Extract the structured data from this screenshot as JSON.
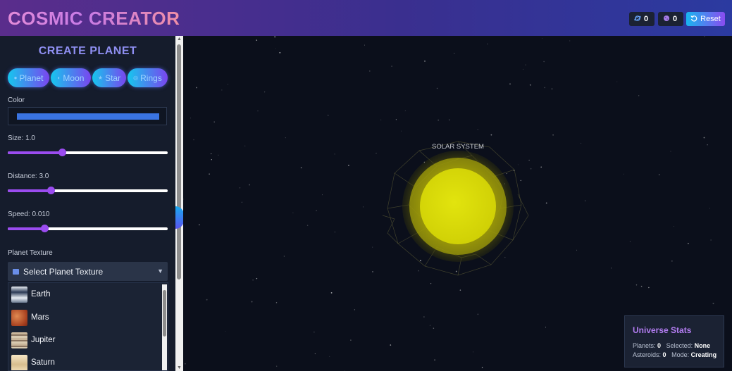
{
  "header": {
    "title": "COSMIC CREATOR",
    "counters": [
      {
        "icon": "planet-icon",
        "value": "0"
      },
      {
        "icon": "asteroid-icon",
        "value": "0"
      }
    ],
    "reset_label": "Reset"
  },
  "sidebar": {
    "title": "CREATE PLANET",
    "types": [
      {
        "label": "Planet",
        "icon": "circle-icon"
      },
      {
        "label": "Moon",
        "icon": "moon-icon"
      },
      {
        "label": "Star",
        "icon": "star-icon"
      },
      {
        "label": "Rings",
        "icon": "ring-icon"
      }
    ],
    "color_label": "Color",
    "color_value": "#3a74e2",
    "size": {
      "label": "Size: 1.0",
      "value": 1.0,
      "fraction": 0.34
    },
    "distance": {
      "label": "Distance: 3.0",
      "value": 3.0,
      "fraction": 0.27
    },
    "speed": {
      "label": "Speed: 0.010",
      "value": 0.01,
      "fraction": 0.23
    },
    "texture_label": "Planet Texture",
    "texture_select": "Select Planet Texture",
    "textures": [
      {
        "name": "Earth",
        "colors": [
          "#cfd8e6",
          "#2b3a55"
        ]
      },
      {
        "name": "Mars",
        "colors": [
          "#d0703e",
          "#8a2f1c"
        ]
      },
      {
        "name": "Jupiter",
        "colors": [
          "#c8b497",
          "#7a6550"
        ]
      },
      {
        "name": "Saturn",
        "colors": [
          "#f1ddb6",
          "#c9ad82"
        ]
      }
    ]
  },
  "scene": {
    "label": "SOLAR SYSTEM",
    "sun_color": "#d8dc0a"
  },
  "stats": {
    "title": "Universe Stats",
    "planets_label": "Planets:",
    "planets_value": "0",
    "selected_label": "Selected:",
    "selected_value": "None",
    "asteroids_label": "Asteroids:",
    "asteroids_value": "0",
    "mode_label": "Mode:",
    "mode_value": "Creating"
  }
}
